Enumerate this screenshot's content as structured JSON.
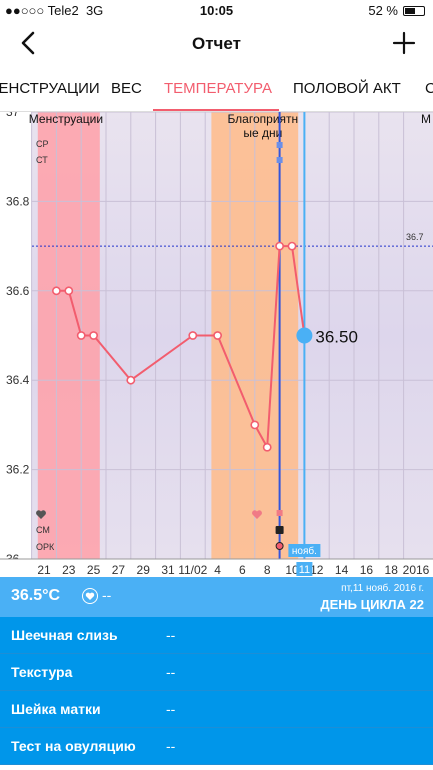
{
  "status_bar": {
    "carrier": "●●○○○ Tele2",
    "network": "3G",
    "time": "10:05",
    "battery": "52 %",
    "battery_level": 0.52
  },
  "nav": {
    "title": "Отчет",
    "back_icon": "chevron-left-icon",
    "add_icon": "plus-icon"
  },
  "tabs": [
    {
      "label": "МЕНСТРУАЦИИ",
      "active": false
    },
    {
      "label": "ВЕС",
      "active": false
    },
    {
      "label": "ТЕМПЕРАТУРА",
      "active": true
    },
    {
      "label": "ПОЛОВОЙ АКТ",
      "active": false
    },
    {
      "label": "С",
      "active": false
    }
  ],
  "chart_data": {
    "type": "line",
    "x": [
      "20 окт.",
      "21 окт.",
      "22 окт.",
      "23 окт.",
      "24 окт.",
      "25 окт.",
      "26 окт.",
      "27 окт.",
      "28 окт.",
      "29 окт.",
      "30 окт.",
      "31 окт.",
      "1 нояб.",
      "2 нояб.",
      "3 нояб.",
      "4 нояб.",
      "5 нояб.",
      "6 нояб.",
      "7 нояб.",
      "8 нояб.",
      "9 нояб.",
      "10 нояб.",
      "11 нояб.",
      "12 нояб.",
      "13 нояб.",
      "14 нояб.",
      "15 нояб.",
      "16 нояб.",
      "17 нояб.",
      "18 нояб.",
      "19 нояб."
    ],
    "x_tick_labels": [
      "21",
      "23",
      "25",
      "27",
      "29",
      "31",
      "11/02",
      "4",
      "6",
      "8",
      "10",
      "12",
      "14",
      "16",
      "18",
      "2016"
    ],
    "y_ticks": [
      36,
      36.2,
      36.4,
      36.6,
      36.8,
      37
    ],
    "y_tick_labels": [
      "36",
      "36.2",
      "36.4",
      "36.6",
      "36.8",
      "37"
    ],
    "ylim": [
      36,
      37
    ],
    "grid": true,
    "series": [
      {
        "color": "#f25d6e",
        "values": [
          {
            "x": "22 окт.",
            "y": 36.6
          },
          {
            "x": "23 окт.",
            "y": 36.6
          },
          {
            "x": "24 окт.",
            "y": 36.5
          },
          {
            "x": "25 окт.",
            "y": 36.5
          },
          {
            "x": "28 окт.",
            "y": 36.4
          },
          {
            "x": "2 нояб.",
            "y": 36.5
          },
          {
            "x": "4 нояб.",
            "y": 36.5
          },
          {
            "x": "7 нояб.",
            "y": 36.3
          },
          {
            "x": "8 нояб.",
            "y": 36.25
          },
          {
            "x": "9 нояб.",
            "y": 36.7
          },
          {
            "x": "10 нояб.",
            "y": 36.7
          },
          {
            "x": "11 нояб.",
            "y": 36.5
          }
        ]
      }
    ],
    "highlight_point": {
      "x": "11 нояб.",
      "y": 36.5,
      "label": "36.50",
      "color": "#4ab0f5"
    },
    "reference_line": {
      "y": 36.7,
      "label": "36.7",
      "color": "#2233cc"
    },
    "bands": [
      {
        "from": "21 окт.",
        "to": "25 окт.",
        "label": "Менструации",
        "color": "#ffa0a8"
      },
      {
        "from": "4 нояб.",
        "to": "10 нояб.",
        "label": "Благоприятные дни",
        "color": "#ffbb88"
      }
    ],
    "truncated_band_label": "М",
    "selected_day": {
      "x": "11 нояб.",
      "tooltip_top": "нояб.",
      "tooltip_bottom": "11",
      "color": "#4ab0f5"
    },
    "ovulation_line": {
      "x": "9 нояб.",
      "color": "#3355dd"
    },
    "row_labels": {
      "top": [
        "СР",
        "СТ"
      ],
      "bottom": [
        "СМ",
        "ОРК"
      ]
    }
  },
  "summary": {
    "temperature": "36.5°C",
    "heart_value": "--",
    "date": "пт,11 нояб. 2016 г.",
    "cycle_day": "ДЕНЬ ЦИКЛА 22"
  },
  "details": [
    {
      "label": "Шеечная слизь",
      "value": "--"
    },
    {
      "label": "Текстура",
      "value": "--"
    },
    {
      "label": "Шейка матки",
      "value": "--"
    },
    {
      "label": "Тест на овуляцию",
      "value": "--"
    }
  ]
}
